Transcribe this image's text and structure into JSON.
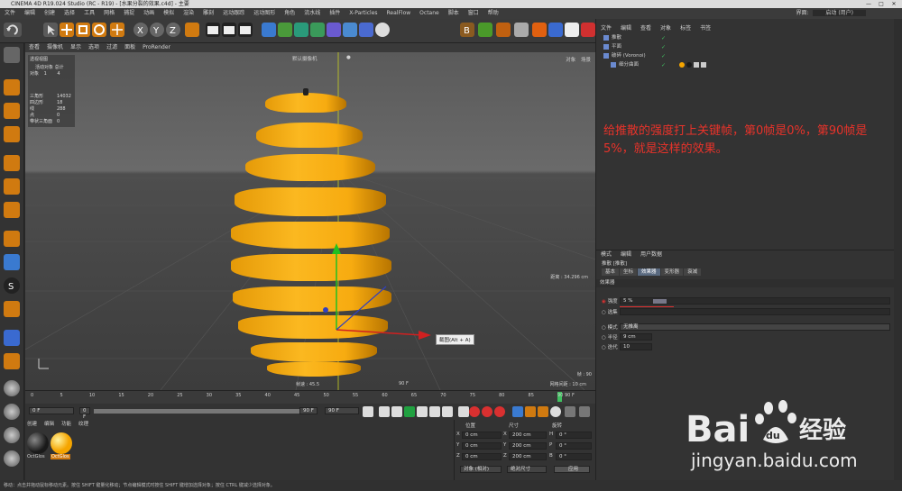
{
  "window": {
    "title": "CINEMA 4D R19.024 Studio (RC - R19) - [水果分裂的效果.c4d] - 主要",
    "controls": [
      "—",
      "□",
      "✕"
    ]
  },
  "menubar": [
    "文件",
    "编辑",
    "创建",
    "选择",
    "工具",
    "网格",
    "捕捉",
    "动画",
    "模拟",
    "渲染",
    "雕刻",
    "运动跟踪",
    "运动图形",
    "角色",
    "流水线",
    "插件",
    "X-Particles",
    "RealFlow",
    "Octane",
    "脚本",
    "窗口",
    "帮助"
  ],
  "layout": {
    "label": "界面:",
    "value": "启动 (用户)"
  },
  "viewport": {
    "menu": [
      "查看",
      "摄像机",
      "显示",
      "选项",
      "过滤",
      "面板",
      "ProRender"
    ],
    "title": "透视视图",
    "camera_label": "默认摄像机",
    "camera_icon": "●",
    "top_right": [
      "对象",
      "场景"
    ],
    "stats": {
      "header": [
        "活动对象",
        "总计"
      ],
      "object_row": [
        "对象",
        "1",
        "4"
      ],
      "rows": [
        [
          "三角形",
          "14032"
        ],
        [
          "四边形",
          "18"
        ],
        [
          "线",
          "288"
        ],
        [
          "点",
          "0"
        ],
        [
          "带状三角面",
          "0"
        ]
      ]
    },
    "grid_spacing": "网格间距 : 10 cm",
    "frame_rate": "帧速 : 45.5",
    "distance": "距离 : 34.296 cm",
    "frame": "帧 : 90",
    "tooltip": "截图(Alt + A)",
    "frame_end": "90 F"
  },
  "timeline": {
    "ticks": [
      "0",
      "5",
      "10",
      "15",
      "20",
      "25",
      "30",
      "35",
      "40",
      "45",
      "50",
      "55",
      "60",
      "65",
      "70",
      "75",
      "80",
      "85",
      "90"
    ],
    "end_label": "90 F",
    "current": "0 F",
    "start": "0 F",
    "end": "90 F",
    "max": "90 F"
  },
  "materials": {
    "menu": [
      "创建",
      "编辑",
      "功能",
      "纹理"
    ],
    "items": [
      {
        "name": "OctGlos",
        "color": "#1a1a1a"
      },
      {
        "name": "OctGlos",
        "color": "#f5a500"
      }
    ]
  },
  "coords": {
    "headers": [
      "位置",
      "尺寸",
      "旋转"
    ],
    "rows": [
      {
        "axis": "X",
        "pos": "0 cm",
        "size": "200 cm",
        "rot_label": "H",
        "rot": "0 °"
      },
      {
        "axis": "Y",
        "pos": "0 cm",
        "size": "200 cm",
        "rot_label": "P",
        "rot": "0 °"
      },
      {
        "axis": "Z",
        "pos": "0 cm",
        "size": "200 cm",
        "rot_label": "B",
        "rot": "0 °"
      }
    ],
    "mode": "对象 (相对)",
    "size_mode": "绝对尺寸",
    "apply": "应用"
  },
  "objects": {
    "menu": [
      "文件",
      "编辑",
      "查看",
      "对象",
      "标签",
      "书签"
    ],
    "rows": [
      {
        "name": "推散",
        "indent": 0
      },
      {
        "name": "平面",
        "indent": 0
      },
      {
        "name": "破碎 (Voronoi)",
        "indent": 0
      },
      {
        "name": "细分曲面",
        "indent": 8
      }
    ]
  },
  "annotation": "给推散的强度打上关键帧，第0帧是0%，第90帧是5%，就是这样的效果。",
  "attributes": {
    "menu": [
      "模式",
      "编辑",
      "用户数据"
    ],
    "object_label": "推散 [推散]",
    "tabs": [
      "基本",
      "坐标",
      "效果器",
      "变形器",
      "衰减"
    ],
    "active_tab": "效果器",
    "section": "效果器",
    "strength_label": "强度",
    "strength_value": "5 %",
    "strength_fill": 0.05,
    "selection_label": "选集",
    "mode_label": "模式",
    "mode_value": "无推离",
    "radius_label": "半径",
    "radius_value": "9 cm",
    "iterations_label": "迭代",
    "iterations_value": "10"
  },
  "statusbar": "移动：点击并拖动鼠标移动元素。按住 SHIFT 键量化移动；节点编辑模式时按住 SHIFT 键增加选择对象；按住 CTRL 键减少选择对象。",
  "watermark": {
    "brand": "Bai",
    "brand_cn": "经验",
    "url": "jingyan.baidu.com",
    "mark": "du"
  },
  "colors": {
    "accent": "#5a6a80",
    "annotation": "#e8332a",
    "fruit": "#f7ab10",
    "keyframe": "#d93030"
  }
}
